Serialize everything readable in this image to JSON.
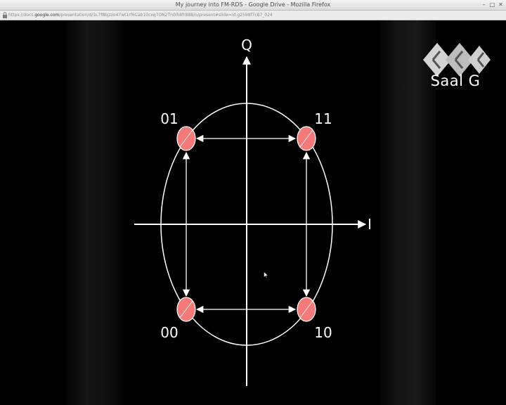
{
  "window": {
    "title": "My journey into FM-RDS - Google Drive - Mozilla Firefox",
    "buttons": [
      "–",
      "□",
      "✕"
    ]
  },
  "addressbar": {
    "url_prefix": "https://docs.",
    "url_domain": "google.com",
    "url_suffix": "/presentation/d/1L7f8bjzzo47wt1rf6Cab10cxq7ON2Tn0ih8fr88B/o/present#slide=id.g2598f7c87_024"
  },
  "slide": {
    "axis_q": "Q",
    "axis_i": "I",
    "points": [
      {
        "label": "01"
      },
      {
        "label": "11"
      },
      {
        "label": "00"
      },
      {
        "label": "10"
      }
    ],
    "point_color": "#f47a7a"
  },
  "logo": {
    "text": "Saal G"
  },
  "icons": {
    "lock": "lock-icon",
    "cursor": "mouse-cursor-icon",
    "logo": "hexagon-logo-icon"
  }
}
